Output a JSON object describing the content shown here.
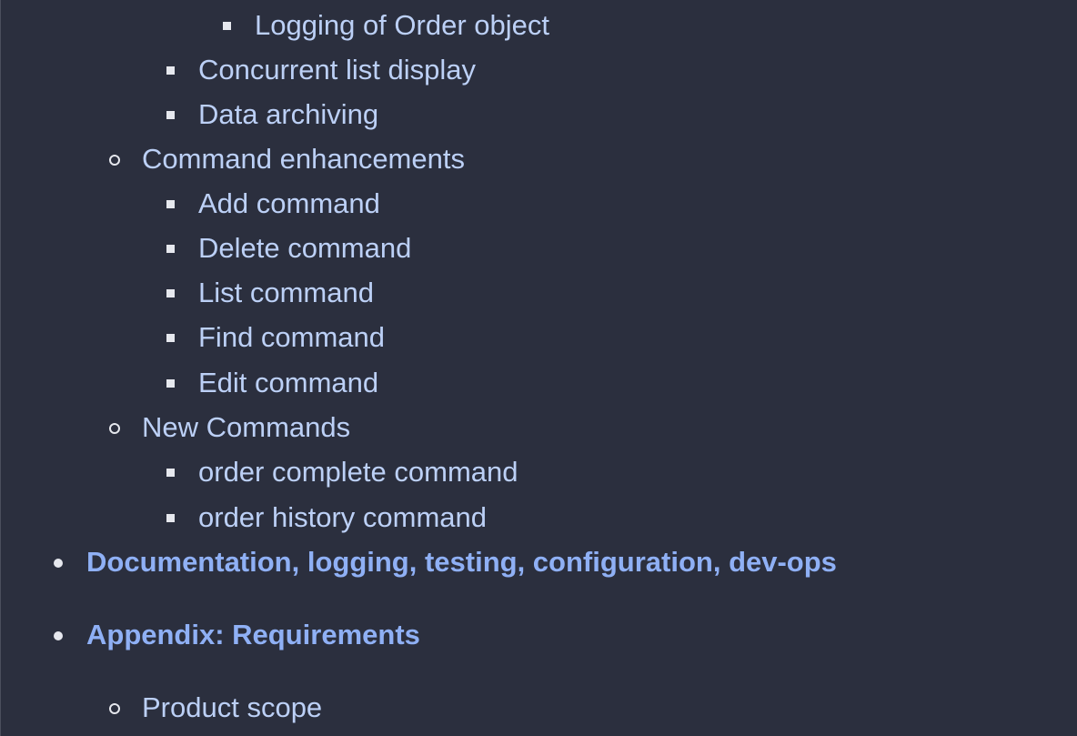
{
  "toc": {
    "items": [
      {
        "label": "Logging of Order object",
        "level": 3,
        "bold": false
      },
      {
        "label": "Concurrent list display",
        "level": 2,
        "bold": false
      },
      {
        "label": "Data archiving",
        "level": 2,
        "bold": false
      },
      {
        "label": "Command enhancements",
        "level": 1,
        "bold": false
      },
      {
        "label": "Add command",
        "level": 2,
        "bold": false
      },
      {
        "label": "Delete command",
        "level": 2,
        "bold": false
      },
      {
        "label": "List command",
        "level": 2,
        "bold": false
      },
      {
        "label": "Find command",
        "level": 2,
        "bold": false
      },
      {
        "label": "Edit command",
        "level": 2,
        "bold": false
      },
      {
        "label": "New Commands",
        "level": 1,
        "bold": false
      },
      {
        "label": "order complete command",
        "level": 2,
        "bold": false
      },
      {
        "label": "order history command",
        "level": 2,
        "bold": false
      },
      {
        "label": "Documentation, logging, testing, configuration, dev-ops",
        "level": 0,
        "bold": true
      },
      {
        "label": "Appendix: Requirements",
        "level": 0,
        "bold": true
      },
      {
        "label": "Product scope",
        "level": 1,
        "bold": false
      }
    ]
  },
  "colors": {
    "background": "#2b2f3e",
    "link": "#bcd0f6",
    "bold_link": "#8fb0f5",
    "bullet": "#e6e8ee"
  }
}
